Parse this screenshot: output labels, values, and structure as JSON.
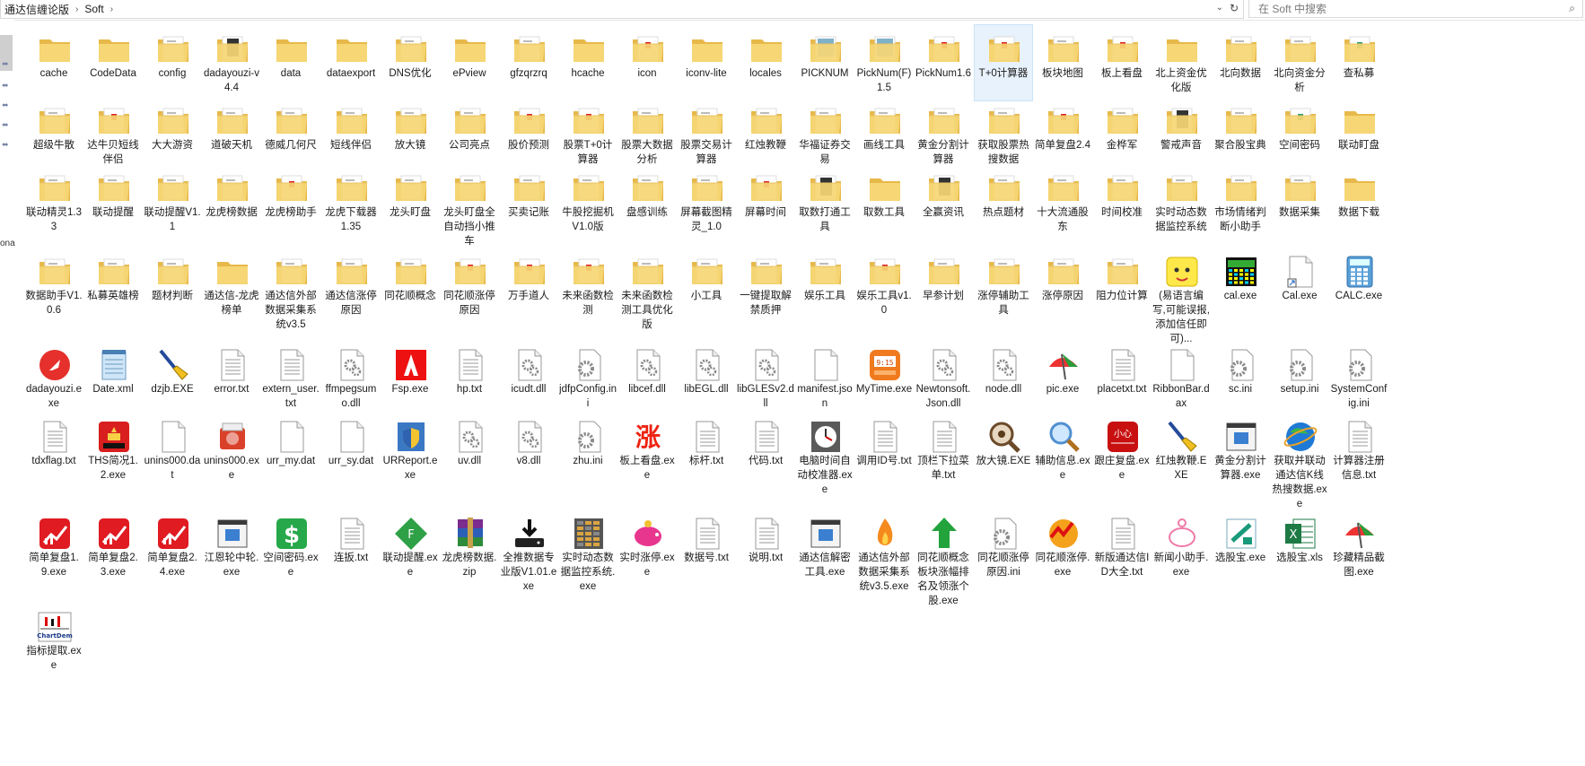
{
  "address": {
    "crumbs": [
      "通达信缠论版",
      "Soft"
    ]
  },
  "search": {
    "placeholder": "在 Soft 中搜索"
  },
  "nav": {
    "fragment": "ona"
  },
  "items": [
    {
      "label": "cache",
      "icon": "folder-icon"
    },
    {
      "label": "CodeData",
      "icon": "folder-icon"
    },
    {
      "label": "config",
      "icon": "folder-docs-icon"
    },
    {
      "label": "dadayouzi-v4.4",
      "icon": "folder-dark-icon"
    },
    {
      "label": "data",
      "icon": "folder-icon"
    },
    {
      "label": "dataexport",
      "icon": "folder-icon"
    },
    {
      "label": "DNS优化",
      "icon": "folder-docs-icon"
    },
    {
      "label": "ePview",
      "icon": "folder-icon"
    },
    {
      "label": "gfzqrzrq",
      "icon": "folder-docs-icon"
    },
    {
      "label": "hcache",
      "icon": "folder-icon"
    },
    {
      "label": "icon",
      "icon": "folder-red-icon"
    },
    {
      "label": "iconv-lite",
      "icon": "folder-icon"
    },
    {
      "label": "locales",
      "icon": "folder-icon"
    },
    {
      "label": "PICKNUM",
      "icon": "folder-blue-icon"
    },
    {
      "label": "PickNum(F) 1.5",
      "icon": "folder-blue-icon"
    },
    {
      "label": "PickNum1.6",
      "icon": "folder-red-icon"
    },
    {
      "label": "T+0计算器",
      "icon": "folder-red-icon",
      "selected": true
    },
    {
      "label": "板块地图",
      "icon": "folder-docs-icon"
    },
    {
      "label": "板上看盘",
      "icon": "folder-red-icon"
    },
    {
      "label": "北上资金优化版",
      "icon": "folder-icon"
    },
    {
      "label": "北向数据",
      "icon": "folder-docs-icon"
    },
    {
      "label": "北向资金分析",
      "icon": "folder-docs-icon"
    },
    {
      "label": "查私募",
      "icon": "folder-green-icon"
    },
    {
      "label": "超级牛散",
      "icon": "folder-docs-icon"
    },
    {
      "label": "达牛贝短线伴侣",
      "icon": "folder-red-icon"
    },
    {
      "label": "大大游资",
      "icon": "folder-docs-icon"
    },
    {
      "label": "道破天机",
      "icon": "folder-docs-icon"
    },
    {
      "label": "德威几何尺",
      "icon": "folder-docs-icon"
    },
    {
      "label": "短线伴侣",
      "icon": "folder-docs-icon"
    },
    {
      "label": "放大镜",
      "icon": "folder-docs-icon"
    },
    {
      "label": "公司亮点",
      "icon": "folder-docs-icon"
    },
    {
      "label": "股价预测",
      "icon": "folder-red-icon"
    },
    {
      "label": "股票T+0计算器",
      "icon": "folder-red-icon"
    },
    {
      "label": "股票大数据分析",
      "icon": "folder-docs-icon"
    },
    {
      "label": "股票交易计算器",
      "icon": "folder-docs-icon"
    },
    {
      "label": "红烛教鞭",
      "icon": "folder-docs-icon"
    },
    {
      "label": "华福证券交易",
      "icon": "folder-docs-icon"
    },
    {
      "label": "画线工具",
      "icon": "folder-docs-icon"
    },
    {
      "label": "黄金分割计算器",
      "icon": "folder-docs-icon"
    },
    {
      "label": "获取股票热搜数据",
      "icon": "folder-docs-icon"
    },
    {
      "label": "简单复盘2.4",
      "icon": "folder-red-icon"
    },
    {
      "label": "金桦军",
      "icon": "folder-docs-icon"
    },
    {
      "label": "警戒声音",
      "icon": "folder-dark-icon"
    },
    {
      "label": "聚合股宝典",
      "icon": "folder-docs-icon"
    },
    {
      "label": "空间密码",
      "icon": "folder-green-icon"
    },
    {
      "label": "联动盯盘",
      "icon": "folder-icon"
    },
    {
      "label": "联动精灵1.33",
      "icon": "folder-docs-icon"
    },
    {
      "label": "联动提醒",
      "icon": "folder-docs-icon"
    },
    {
      "label": "联动提醒V1.1",
      "icon": "folder-docs-icon"
    },
    {
      "label": "龙虎榜数据",
      "icon": "folder-docs-icon"
    },
    {
      "label": "龙虎榜助手",
      "icon": "folder-red-icon"
    },
    {
      "label": "龙虎下载器1.35",
      "icon": "folder-docs-icon"
    },
    {
      "label": "龙头盯盘",
      "icon": "folder-docs-icon"
    },
    {
      "label": "龙头盯盘全自动挡小推车",
      "icon": "folder-docs-icon"
    },
    {
      "label": "买卖记账",
      "icon": "folder-docs-icon"
    },
    {
      "label": "牛股挖掘机V1.0版",
      "icon": "folder-docs-icon"
    },
    {
      "label": "盘感训练",
      "icon": "folder-docs-icon"
    },
    {
      "label": "屏幕截图精灵_1.0",
      "icon": "folder-docs-icon"
    },
    {
      "label": "屏幕时间",
      "icon": "folder-red-icon"
    },
    {
      "label": "取数打通工具",
      "icon": "folder-dark-icon"
    },
    {
      "label": "取数工具",
      "icon": "folder-icon"
    },
    {
      "label": "全赢资讯",
      "icon": "folder-dark-icon"
    },
    {
      "label": "热点题材",
      "icon": "folder-docs-icon"
    },
    {
      "label": "十大流通股东",
      "icon": "folder-docs-icon"
    },
    {
      "label": "时间校准",
      "icon": "folder-docs-icon"
    },
    {
      "label": "实时动态数据监控系统",
      "icon": "folder-docs-icon"
    },
    {
      "label": "市场情绪判断小助手",
      "icon": "folder-docs-icon"
    },
    {
      "label": "数据采集",
      "icon": "folder-docs-icon"
    },
    {
      "label": "数据下载",
      "icon": "folder-icon"
    },
    {
      "label": "数据助手V1.0.6",
      "icon": "folder-docs-icon"
    },
    {
      "label": "私募英雄榜",
      "icon": "folder-docs-icon"
    },
    {
      "label": "题材判断",
      "icon": "folder-docs-icon"
    },
    {
      "label": "通达信-龙虎榜单",
      "icon": "folder-icon"
    },
    {
      "label": "通达信外部数据采集系统v3.5",
      "icon": "folder-docs-icon"
    },
    {
      "label": "通达信涨停原因",
      "icon": "folder-docs-icon"
    },
    {
      "label": "同花顺概念",
      "icon": "folder-docs-icon"
    },
    {
      "label": "同花顺涨停原因",
      "icon": "folder-red-icon"
    },
    {
      "label": "万手道人",
      "icon": "folder-red-icon"
    },
    {
      "label": "未来函数检测",
      "icon": "folder-red-icon"
    },
    {
      "label": "未来函数检测工具优化版",
      "icon": "folder-docs-icon"
    },
    {
      "label": "小工具",
      "icon": "folder-docs-icon"
    },
    {
      "label": "一键提取解禁质押",
      "icon": "folder-docs-icon"
    },
    {
      "label": "娱乐工具",
      "icon": "folder-docs-icon"
    },
    {
      "label": "娱乐工具v1.0",
      "icon": "folder-red-icon"
    },
    {
      "label": "早参计划",
      "icon": "folder-docs-icon"
    },
    {
      "label": "涨停辅助工具",
      "icon": "folder-docs-icon"
    },
    {
      "label": "涨停原因",
      "icon": "folder-docs-icon"
    },
    {
      "label": "阻力位计算",
      "icon": "folder-docs-icon"
    },
    {
      "label": "(易语言编写,可能误报,添加信任即可)...",
      "icon": "yellow-face-icon"
    },
    {
      "label": "cal.exe",
      "icon": "calendar-app-icon"
    },
    {
      "label": "Cal.exe",
      "icon": "shortcut-file-icon"
    },
    {
      "label": "CALC.exe",
      "icon": "calculator-icon"
    },
    {
      "label": "dadayouzi.exe",
      "icon": "rocket-icon"
    },
    {
      "label": "Date.xml",
      "icon": "notepad-icon"
    },
    {
      "label": "dzjb.EXE",
      "icon": "broom-icon"
    },
    {
      "label": "error.txt",
      "icon": "text-file-icon"
    },
    {
      "label": "extern_user.txt",
      "icon": "text-file-icon"
    },
    {
      "label": "ffmpegsumo.dll",
      "icon": "gear-file-icon"
    },
    {
      "label": "Fsp.exe",
      "icon": "red-a-icon"
    },
    {
      "label": "hp.txt",
      "icon": "text-file-icon"
    },
    {
      "label": "icudt.dll",
      "icon": "gear-file-icon"
    },
    {
      "label": "jdfpConfig.ini",
      "icon": "ini-gear-icon"
    },
    {
      "label": "libcef.dll",
      "icon": "gear-file-icon"
    },
    {
      "label": "libEGL.dll",
      "icon": "gear-file-icon"
    },
    {
      "label": "libGLESv2.dll",
      "icon": "gear-file-icon"
    },
    {
      "label": "manifest.json",
      "icon": "blank-file-icon"
    },
    {
      "label": "MyTime.exe",
      "icon": "mytime-clock-icon"
    },
    {
      "label": "Newtonsoft.Json.dll",
      "icon": "gear-file-icon"
    },
    {
      "label": "node.dll",
      "icon": "gear-file-icon"
    },
    {
      "label": "pic.exe",
      "icon": "umbrella-icon"
    },
    {
      "label": "placetxt.txt",
      "icon": "text-file-icon"
    },
    {
      "label": "RibbonBar.dax",
      "icon": "blank-file-icon"
    },
    {
      "label": "sc.ini",
      "icon": "ini-gear-icon"
    },
    {
      "label": "setup.ini",
      "icon": "ini-gear-icon"
    },
    {
      "label": "SystemConfig.ini",
      "icon": "ini-gear-icon"
    },
    {
      "label": "tdxflag.txt",
      "icon": "text-file-icon"
    },
    {
      "label": "THS简况1.2.exe",
      "icon": "ths-news-icon"
    },
    {
      "label": "unins000.dat",
      "icon": "blank-file-icon"
    },
    {
      "label": "unins000.exe",
      "icon": "installer-icon"
    },
    {
      "label": "urr_my.dat",
      "icon": "blank-file-icon"
    },
    {
      "label": "urr_sy.dat",
      "icon": "blank-file-icon"
    },
    {
      "label": "URReport.exe",
      "icon": "shield-app-icon"
    },
    {
      "label": "uv.dll",
      "icon": "gear-file-icon"
    },
    {
      "label": "v8.dll",
      "icon": "gear-file-icon"
    },
    {
      "label": "zhu.ini",
      "icon": "ini-gear-icon"
    },
    {
      "label": "板上看盘.exe",
      "icon": "zhang-icon"
    },
    {
      "label": "标杆.txt",
      "icon": "text-file-icon"
    },
    {
      "label": "代码.txt",
      "icon": "text-file-icon"
    },
    {
      "label": "电脑时间自动校准器.exe",
      "icon": "clock-icon"
    },
    {
      "label": "调用ID号.txt",
      "icon": "text-file-icon"
    },
    {
      "label": "顶栏下拉菜单.txt",
      "icon": "text-file-icon"
    },
    {
      "label": "放大镜.EXE",
      "icon": "eye-magnifier-icon"
    },
    {
      "label": "辅助信息.exe",
      "icon": "magnifier-icon"
    },
    {
      "label": "跟庄复盘.exe",
      "icon": "red-app-icon"
    },
    {
      "label": "红烛教鞭.EXE",
      "icon": "broom-icon"
    },
    {
      "label": "黄金分割计算器.exe",
      "icon": "window-app-icon"
    },
    {
      "label": "获取并联动通达信K线热搜数据.exe",
      "icon": "globe-icon"
    },
    {
      "label": "计算器注册信息.txt",
      "icon": "text-file-icon"
    },
    {
      "label": "简单复盘1.9.exe",
      "icon": "red-chart-icon"
    },
    {
      "label": "简单复盘2.3.exe",
      "icon": "red-chart-icon"
    },
    {
      "label": "简单复盘2.4.exe",
      "icon": "red-chart-icon"
    },
    {
      "label": "江恩轮中轮.exe",
      "icon": "window-app-icon"
    },
    {
      "label": "空间密码.exe",
      "icon": "dollar-icon"
    },
    {
      "label": "连扳.txt",
      "icon": "text-file-icon"
    },
    {
      "label": "联动提醒.exe",
      "icon": "green-diamond-icon"
    },
    {
      "label": "龙虎榜数据.zip",
      "icon": "winrar-icon"
    },
    {
      "label": "全推数据专业版V1.01.exe",
      "icon": "download-icon"
    },
    {
      "label": "实时动态数据监控系统.exe",
      "icon": "data-grid-icon"
    },
    {
      "label": "实时涨停.exe",
      "icon": "piggy-icon"
    },
    {
      "label": "数据号.txt",
      "icon": "text-file-icon"
    },
    {
      "label": "说明.txt",
      "icon": "text-file-icon"
    },
    {
      "label": "通达信解密工具.exe",
      "icon": "window-app-icon"
    },
    {
      "label": "通达信外部数据采集系统v3.5.exe",
      "icon": "flame-icon"
    },
    {
      "label": "同花顺概念板块涨幅排名及领涨个股.exe",
      "icon": "green-arrow-icon"
    },
    {
      "label": "同花顺涨停原因.ini",
      "icon": "ini-gear-icon"
    },
    {
      "label": "同花顺涨停.exe",
      "icon": "zigzag-icon"
    },
    {
      "label": "新版通达信ID大全.txt",
      "icon": "text-file-icon"
    },
    {
      "label": "新闻小助手.exe",
      "icon": "pink-piggy-icon"
    },
    {
      "label": "选股宝.exe",
      "icon": "green-box-icon"
    },
    {
      "label": "选股宝.xls",
      "icon": "excel-icon"
    },
    {
      "label": "珍藏精品截图.exe",
      "icon": "umbrella-icon"
    },
    {
      "label": "指标提取.exe",
      "icon": "chartdem-icon"
    }
  ]
}
